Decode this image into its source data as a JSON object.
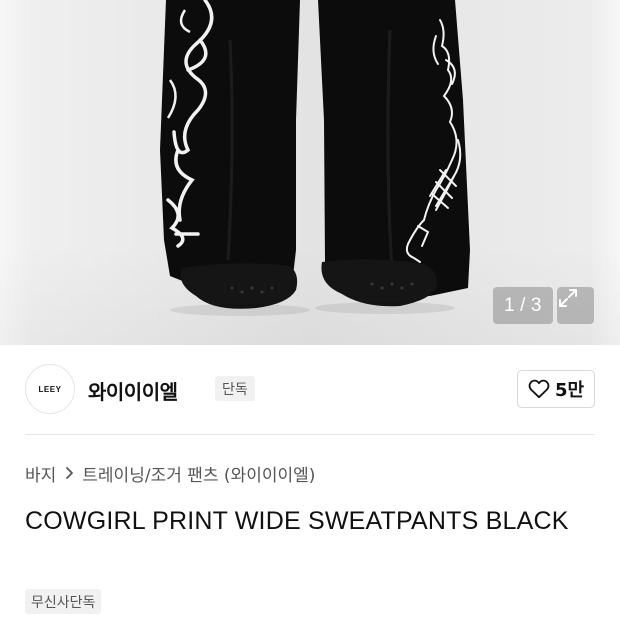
{
  "gallery": {
    "current": "1",
    "separator": "/",
    "total": "3",
    "expand_icon": "expand-icon"
  },
  "brand": {
    "logo_text": "LEEY",
    "name": "와이이이엘",
    "badge": "단독",
    "like_icon": "heart-icon",
    "like_count": "5만"
  },
  "breadcrumb": {
    "level1": "바지",
    "chevron_icon": "chevron-right-icon",
    "level2": "트레이닝/조거 팬츠 (와이이이엘)"
  },
  "product": {
    "title": "COWGIRL PRINT WIDE SWEATPANTS BLACK",
    "exclusive_badge": "무신사단독"
  },
  "colors": {
    "background": "#ffffff",
    "text_primary": "#111111",
    "text_secondary": "#555555",
    "badge_bg": "#f1f1f1",
    "overlay": "#8c8c8c"
  }
}
